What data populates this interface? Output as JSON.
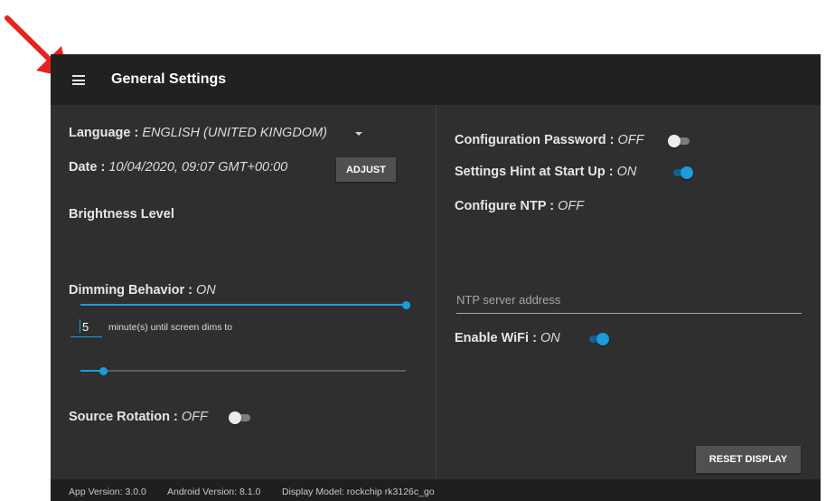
{
  "header": {
    "title": "General Settings"
  },
  "icons": {
    "menu": "hamburger-menu-icon",
    "annotation": "red-arrow-icon"
  },
  "colors": {
    "accent": "#1a9cde",
    "background": "#2f2f2f",
    "topbar": "#212121",
    "annotation_arrow": "#e8231f"
  },
  "left": {
    "language": {
      "label": "Language :",
      "value": "ENGLISH (UNITED KINGDOM)"
    },
    "date": {
      "label": "Date :",
      "value": "10/04/2020, 09:07 GMT+00:00",
      "button": "ADJUST"
    },
    "brightness": {
      "label": "Brightness Level",
      "level_percent": 100
    },
    "dimming": {
      "label": "Dimming Behavior :",
      "state": "ON",
      "minutes": "5",
      "text": "minute(s) until screen dims to",
      "level_percent": 7
    },
    "source_rotation": {
      "label": "Source Rotation :",
      "state": "OFF",
      "enabled": false
    }
  },
  "right": {
    "config_password": {
      "label": "Configuration Password :",
      "state": "OFF",
      "enabled": false
    },
    "settings_hint": {
      "label": "Settings Hint at Start Up :",
      "state": "ON",
      "enabled": true
    },
    "ntp": {
      "label": "Configure NTP :",
      "state": "OFF",
      "placeholder": "NTP server address"
    },
    "wifi": {
      "label": "Enable WiFi :",
      "state": "ON",
      "enabled": true
    },
    "reset_button": "RESET DISPLAY"
  },
  "footer": {
    "app_version": "App Version: 3.0.0",
    "android_version": "Android Version: 8.1.0",
    "display_model": "Display Model: rockchip rk3126c_go"
  }
}
